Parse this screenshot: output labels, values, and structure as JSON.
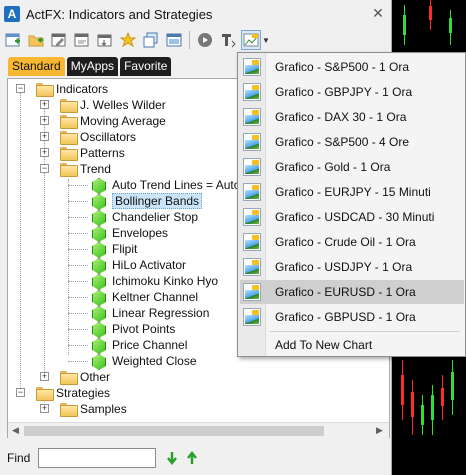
{
  "window": {
    "title": "ActFX: Indicators and Strategies"
  },
  "toolbar": {
    "buttons": [
      "new-indicator-icon",
      "open-folder-icon",
      "edit-icon",
      "edit-alt-icon",
      "import-icon",
      "favorite-star-icon",
      "copy-icon",
      "window-icon",
      "run-icon",
      "text-tool-icon",
      "chart-icon"
    ]
  },
  "tabs": [
    {
      "label": "Standard",
      "active": true
    },
    {
      "label": "MyApps",
      "active": false
    },
    {
      "label": "Favorite",
      "active": false
    }
  ],
  "tree": {
    "indicators": "Indicators",
    "j_welles": "J. Welles Wilder",
    "moving_average": "Moving Average",
    "oscillators": "Oscillators",
    "patterns": "Patterns",
    "trend": "Trend",
    "trend_items": [
      "Auto Trend Lines = Auto T",
      "Bollinger Bands",
      "Chandelier Stop",
      "Envelopes",
      "Flipit",
      "HiLo Activator",
      "Ichimoku Kinko Hyo",
      "Keltner Channel",
      "Linear Regression",
      "Pivot Points",
      "Price Channel",
      "Weighted Close"
    ],
    "other": "Other",
    "strategies": "Strategies",
    "samples": "Samples"
  },
  "find": {
    "label": "Find",
    "value": ""
  },
  "menu": {
    "items": [
      "Grafico - S&P500 - 1 Ora",
      "Grafico - GBPJPY - 1 Ora",
      "Grafico - DAX 30 - 1 Ora",
      "Grafico - S&P500 - 4 Ore",
      "Grafico - Gold - 1 Ora",
      "Grafico - EURJPY - 15 Minuti",
      "Grafico - USDCAD - 30 Minuti",
      "Grafico - Crude Oil - 1 Ora",
      "Grafico - USDJPY - 1 Ora",
      "Grafico - EURUSD - 1 Ora",
      "Grafico - GBPUSD - 1 Ora"
    ],
    "highlighted_index": 9,
    "add_new": "Add To New Chart"
  },
  "colors": {
    "accent_tab": "#f7b733",
    "tab_dark": "#1e1e1e",
    "selection": "#cce4f7",
    "menu_highlight": "#cfcfcf"
  }
}
